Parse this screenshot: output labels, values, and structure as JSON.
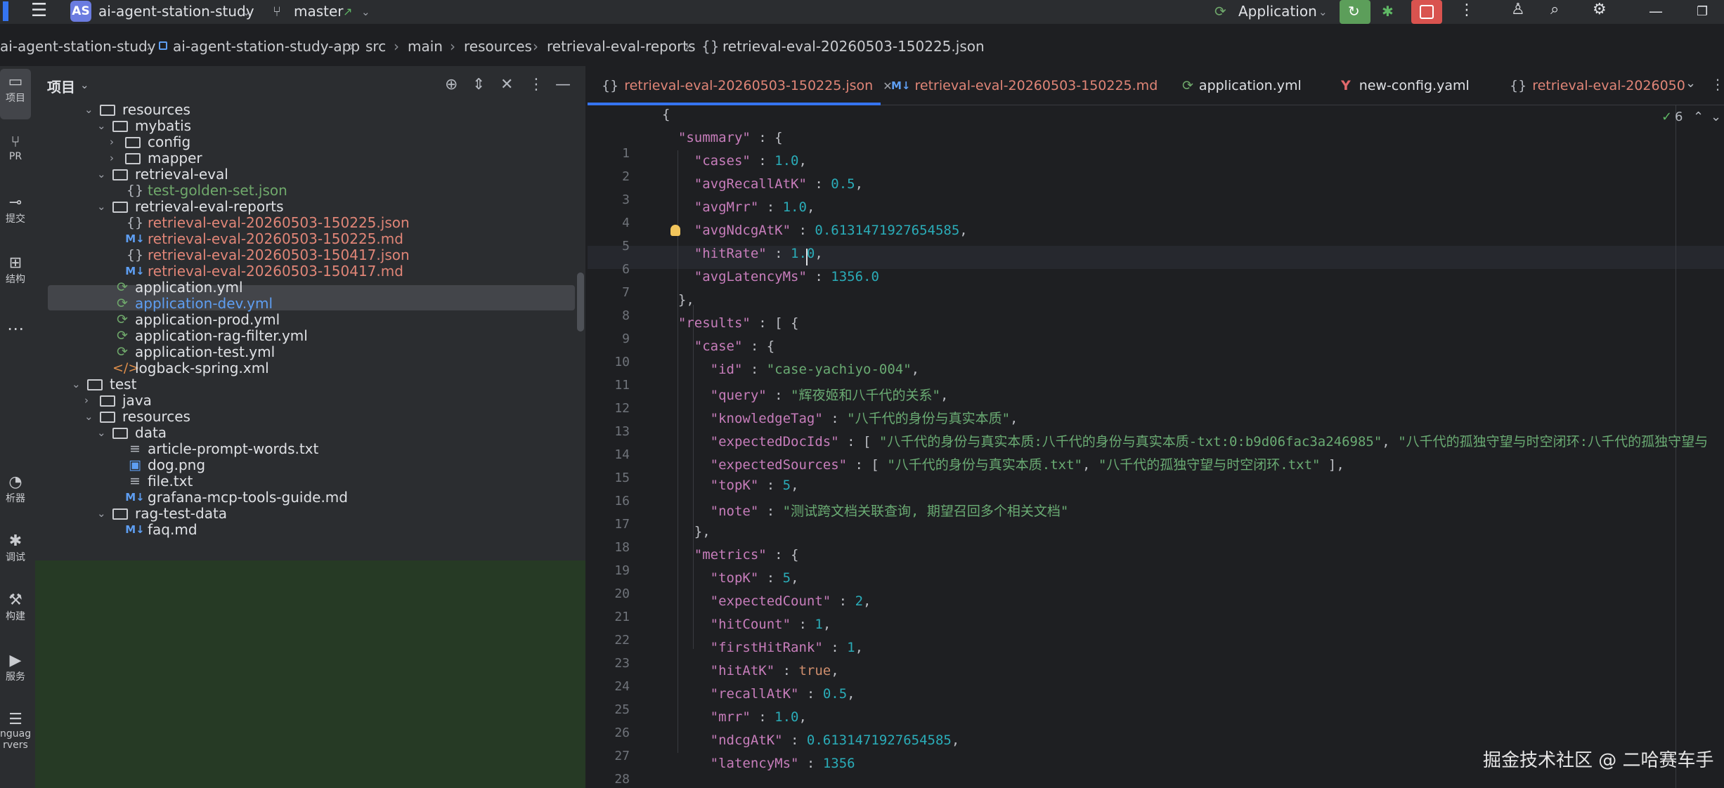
{
  "titlebar": {
    "project_badge": "AS",
    "project_name": "ai-agent-station-study",
    "branch": "master",
    "run_config": "Application",
    "icons": [
      "hamburger-icon",
      "branch-icon",
      "run-icon",
      "debug-icon",
      "stop-icon",
      "more-icon",
      "add-user-icon",
      "search-icon",
      "settings-icon",
      "minimize-icon",
      "restore-icon"
    ]
  },
  "breadcrumb": [
    "ai-agent-station-study",
    "ai-agent-station-study-app",
    "src",
    "main",
    "resources",
    "retrieval-eval-reports",
    "retrieval-eval-20260503-150225.json"
  ],
  "toolstrip": [
    {
      "label": "项目",
      "icon": "folder-icon"
    },
    {
      "label": "PR",
      "icon": "pull-request-icon"
    },
    {
      "label": "提交",
      "icon": "commit-icon"
    },
    {
      "label": "结构",
      "icon": "structure-icon"
    },
    {
      "label": "析器",
      "icon": "profiler-icon"
    },
    {
      "label": "调试",
      "icon": "debug-icon"
    },
    {
      "label": "构建",
      "icon": "build-icon"
    },
    {
      "label": "服务",
      "icon": "services-icon"
    },
    {
      "label": "nguag",
      "icon": "language-icon"
    },
    {
      "label": "rvers",
      "icon": "servers-icon"
    }
  ],
  "project_panel": {
    "title": "项目",
    "tree": [
      {
        "name": "resources",
        "kind": "folder",
        "open": true,
        "color": "white"
      },
      {
        "name": "mybatis",
        "kind": "folder",
        "open": true,
        "color": "white"
      },
      {
        "name": "config",
        "kind": "folder",
        "open": false,
        "color": "white"
      },
      {
        "name": "mapper",
        "kind": "folder",
        "open": false,
        "color": "white"
      },
      {
        "name": "retrieval-eval",
        "kind": "folder",
        "open": true,
        "color": "white"
      },
      {
        "name": "test-golden-set.json",
        "kind": "json",
        "color": "green"
      },
      {
        "name": "retrieval-eval-reports",
        "kind": "folder",
        "open": true,
        "color": "white"
      },
      {
        "name": "retrieval-eval-20260503-150225.json",
        "kind": "json",
        "color": "red",
        "selected": true
      },
      {
        "name": "retrieval-eval-20260503-150225.md",
        "kind": "md",
        "color": "red"
      },
      {
        "name": "retrieval-eval-20260503-150417.json",
        "kind": "json",
        "color": "red"
      },
      {
        "name": "retrieval-eval-20260503-150417.md",
        "kind": "md",
        "color": "red"
      },
      {
        "name": "application.yml",
        "kind": "yml",
        "color": "white"
      },
      {
        "name": "application-dev.yml",
        "kind": "yml",
        "color": "blue"
      },
      {
        "name": "application-prod.yml",
        "kind": "yml",
        "color": "white"
      },
      {
        "name": "application-rag-filter.yml",
        "kind": "yml",
        "color": "white"
      },
      {
        "name": "application-test.yml",
        "kind": "yml",
        "color": "white"
      },
      {
        "name": "logback-spring.xml",
        "kind": "xml",
        "color": "white"
      },
      {
        "name": "test",
        "kind": "folder",
        "open": true,
        "color": "white"
      },
      {
        "name": "java",
        "kind": "folder",
        "open": false,
        "color": "white"
      },
      {
        "name": "resources",
        "kind": "folder",
        "open": true,
        "color": "white"
      },
      {
        "name": "data",
        "kind": "folder",
        "open": true,
        "color": "white"
      },
      {
        "name": "article-prompt-words.txt",
        "kind": "txt",
        "color": "white"
      },
      {
        "name": "dog.png",
        "kind": "png",
        "color": "white"
      },
      {
        "name": "file.txt",
        "kind": "txt",
        "color": "white"
      },
      {
        "name": "grafana-mcp-tools-guide.md",
        "kind": "md",
        "color": "white"
      },
      {
        "name": "rag-test-data",
        "kind": "folder",
        "open": true,
        "color": "white"
      },
      {
        "name": "faq.md",
        "kind": "md",
        "color": "white"
      }
    ]
  },
  "editor": {
    "tabs": [
      {
        "label": "retrieval-eval-20260503-150225.json",
        "kind": "json",
        "active": true
      },
      {
        "label": "retrieval-eval-20260503-150225.md",
        "kind": "md"
      },
      {
        "label": "application.yml",
        "kind": "yml"
      },
      {
        "label": "new-config.yaml",
        "kind": "yaml"
      },
      {
        "label": "retrieval-eval-2026050",
        "kind": "json"
      }
    ],
    "inspection_count": "6",
    "lines": [
      [
        [
          "p",
          "{"
        ]
      ],
      [
        [
          "p",
          "  "
        ],
        [
          "k",
          "\"summary\""
        ],
        [
          "p",
          " : {"
        ]
      ],
      [
        [
          "p",
          "    "
        ],
        [
          "k",
          "\"cases\""
        ],
        [
          "p",
          " : "
        ],
        [
          "n",
          "1.0"
        ],
        [
          "p",
          ","
        ]
      ],
      [
        [
          "p",
          "    "
        ],
        [
          "k",
          "\"avgRecallAtK\""
        ],
        [
          "p",
          " : "
        ],
        [
          "n",
          "0.5"
        ],
        [
          "p",
          ","
        ]
      ],
      [
        [
          "p",
          "    "
        ],
        [
          "k",
          "\"avgMrr\""
        ],
        [
          "p",
          " : "
        ],
        [
          "n",
          "1.0"
        ],
        [
          "p",
          ","
        ]
      ],
      [
        [
          "p",
          "    "
        ],
        [
          "k",
          "\"avgNdcgAtK\""
        ],
        [
          "p",
          " : "
        ],
        [
          "n",
          "0.6131471927654585"
        ],
        [
          "p",
          ","
        ]
      ],
      [
        [
          "p",
          "    "
        ],
        [
          "k",
          "\"hitRate\""
        ],
        [
          "p",
          " : "
        ],
        [
          "n",
          "1.0"
        ],
        [
          "p",
          ","
        ]
      ],
      [
        [
          "p",
          "    "
        ],
        [
          "k",
          "\"avgLatencyMs\""
        ],
        [
          "p",
          " : "
        ],
        [
          "n",
          "1356.0"
        ]
      ],
      [
        [
          "p",
          "  },"
        ]
      ],
      [
        [
          "p",
          "  "
        ],
        [
          "k",
          "\"results\""
        ],
        [
          "p",
          " : [ {"
        ]
      ],
      [
        [
          "p",
          "    "
        ],
        [
          "k",
          "\"case\""
        ],
        [
          "p",
          " : {"
        ]
      ],
      [
        [
          "p",
          "      "
        ],
        [
          "k",
          "\"id\""
        ],
        [
          "p",
          " : "
        ],
        [
          "s",
          "\"case-yachiyo-004\""
        ],
        [
          "p",
          ","
        ]
      ],
      [
        [
          "p",
          "      "
        ],
        [
          "k",
          "\"query\""
        ],
        [
          "p",
          " : "
        ],
        [
          "s",
          "\"辉夜姬和八千代的关系\""
        ],
        [
          "p",
          ","
        ]
      ],
      [
        [
          "p",
          "      "
        ],
        [
          "k",
          "\"knowledgeTag\""
        ],
        [
          "p",
          " : "
        ],
        [
          "s",
          "\"八千代的身份与真实本质\""
        ],
        [
          "p",
          ","
        ]
      ],
      [
        [
          "p",
          "      "
        ],
        [
          "k",
          "\"expectedDocIds\""
        ],
        [
          "p",
          " : [ "
        ],
        [
          "s",
          "\"八千代的身份与真实本质:八千代的身份与真实本质-txt:0:b9d06fac3a246985\""
        ],
        [
          "p",
          ", "
        ],
        [
          "s",
          "\"八千代的孤独守望与时空闭环:八千代的孤独守望与"
        ]
      ],
      [
        [
          "p",
          "      "
        ],
        [
          "k",
          "\"expectedSources\""
        ],
        [
          "p",
          " : [ "
        ],
        [
          "s",
          "\"八千代的身份与真实本质.txt\""
        ],
        [
          "p",
          ", "
        ],
        [
          "s",
          "\"八千代的孤独守望与时空闭环.txt\""
        ],
        [
          "p",
          " ],"
        ]
      ],
      [
        [
          "p",
          "      "
        ],
        [
          "k",
          "\"topK\""
        ],
        [
          "p",
          " : "
        ],
        [
          "n",
          "5"
        ],
        [
          "p",
          ","
        ]
      ],
      [
        [
          "p",
          "      "
        ],
        [
          "k",
          "\"note\""
        ],
        [
          "p",
          " : "
        ],
        [
          "s",
          "\"测试跨文档关联查询, 期望召回多个相关文档\""
        ]
      ],
      [
        [
          "p",
          "    },"
        ]
      ],
      [
        [
          "p",
          "    "
        ],
        [
          "k",
          "\"metrics\""
        ],
        [
          "p",
          " : {"
        ]
      ],
      [
        [
          "p",
          "      "
        ],
        [
          "k",
          "\"topK\""
        ],
        [
          "p",
          " : "
        ],
        [
          "n",
          "5"
        ],
        [
          "p",
          ","
        ]
      ],
      [
        [
          "p",
          "      "
        ],
        [
          "k",
          "\"expectedCount\""
        ],
        [
          "p",
          " : "
        ],
        [
          "n",
          "2"
        ],
        [
          "p",
          ","
        ]
      ],
      [
        [
          "p",
          "      "
        ],
        [
          "k",
          "\"hitCount\""
        ],
        [
          "p",
          " : "
        ],
        [
          "n",
          "1"
        ],
        [
          "p",
          ","
        ]
      ],
      [
        [
          "p",
          "      "
        ],
        [
          "k",
          "\"firstHitRank\""
        ],
        [
          "p",
          " : "
        ],
        [
          "n",
          "1"
        ],
        [
          "p",
          ","
        ]
      ],
      [
        [
          "p",
          "      "
        ],
        [
          "k",
          "\"hitAtK\""
        ],
        [
          "p",
          " : "
        ],
        [
          "b",
          "true"
        ],
        [
          "p",
          ","
        ]
      ],
      [
        [
          "p",
          "      "
        ],
        [
          "k",
          "\"recallAtK\""
        ],
        [
          "p",
          " : "
        ],
        [
          "n",
          "0.5"
        ],
        [
          "p",
          ","
        ]
      ],
      [
        [
          "p",
          "      "
        ],
        [
          "k",
          "\"mrr\""
        ],
        [
          "p",
          " : "
        ],
        [
          "n",
          "1.0"
        ],
        [
          "p",
          ","
        ]
      ],
      [
        [
          "p",
          "      "
        ],
        [
          "k",
          "\"ndcgAtK\""
        ],
        [
          "p",
          " : "
        ],
        [
          "n",
          "0.6131471927654585"
        ],
        [
          "p",
          ","
        ]
      ],
      [
        [
          "p",
          "      "
        ],
        [
          "k",
          "\"latencyMs\""
        ],
        [
          "p",
          " : "
        ],
        [
          "n",
          "1356"
        ]
      ]
    ]
  },
  "watermark": "掘金技术社区 @ 二哈赛车手",
  "colors": {
    "accent": "#3574f0",
    "run_green": "#5c9e5a",
    "stop_red": "#d9534f",
    "vcs_added_bg": "#263a25"
  }
}
